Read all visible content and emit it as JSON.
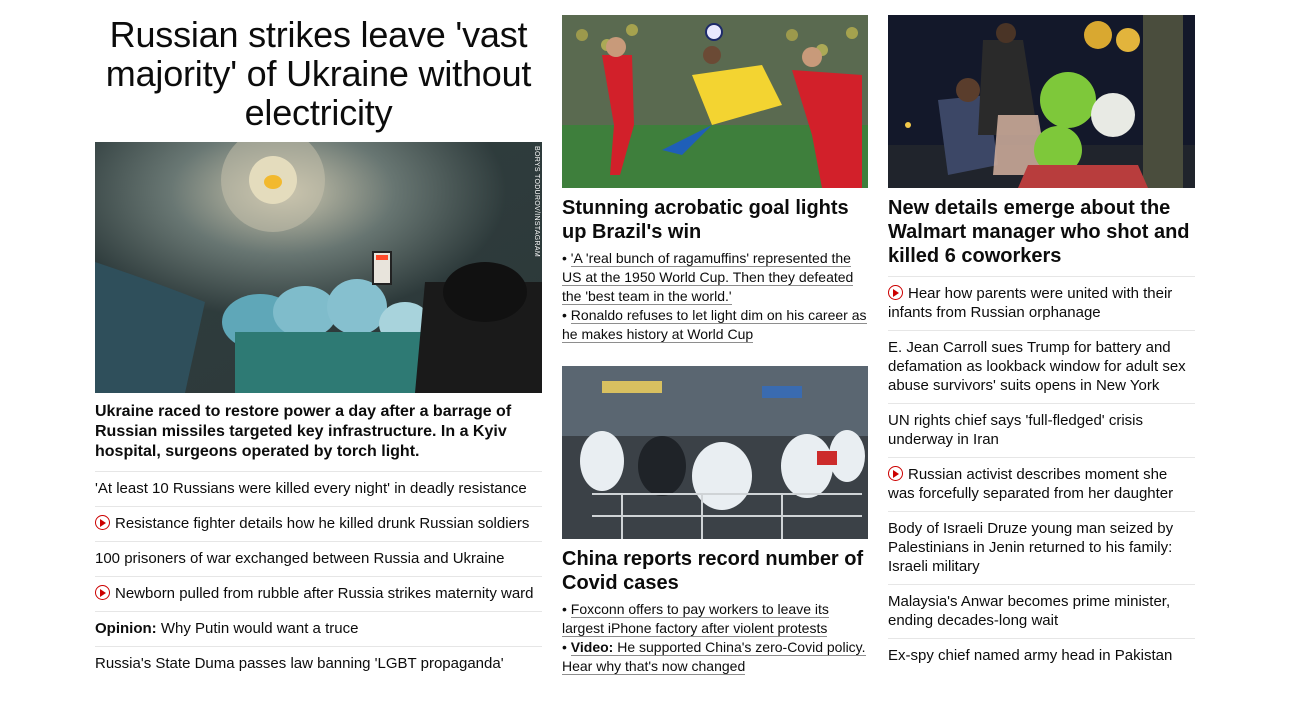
{
  "hero": {
    "title": "Russian strikes leave 'vast majority' of Ukraine without electricity",
    "image_credit": "BORYS TODUROV/INSTAGRAM",
    "dek": "Ukraine raced to restore power a day after a barrage of Russian missiles targeted key infrastructure. In a Kyiv hospital, surgeons operated by torch light.",
    "links": [
      {
        "text": "'At least 10 Russians were killed every night' in deadly resistance",
        "video": false
      },
      {
        "text": "Resistance fighter details how he killed drunk Russian soldiers",
        "video": true
      },
      {
        "text": "100 prisoners of war exchanged between Russia and Ukraine",
        "video": false
      },
      {
        "text": "Newborn pulled from rubble after Russia strikes maternity ward",
        "video": true
      },
      {
        "prefix": "Opinion:",
        "text": " Why Putin would want a truce",
        "video": false
      },
      {
        "text": "Russia's State Duma passes law banning 'LGBT propaganda'",
        "video": false
      }
    ]
  },
  "brazil": {
    "title": "Stunning acrobatic goal lights up Brazil's win",
    "bullets": [
      "'A 'real bunch of ragamuffins' represented the US at the 1950 World Cup. Then they defeated the 'best team in the world.'",
      "Ronaldo refuses to let light dim on his career as he makes history at World Cup"
    ]
  },
  "china": {
    "title": "China reports record number of Covid cases",
    "bullets": [
      {
        "prefix": "",
        "text": "Foxconn offers to pay workers to leave its largest iPhone factory after violent protests"
      },
      {
        "prefix": "Video:",
        "text": " He supported China's zero-Covid policy. Hear why that's now changed"
      }
    ]
  },
  "walmart": {
    "title": "New details emerge about the Walmart manager who shot and killed 6 coworkers",
    "links": [
      {
        "text": "Hear how parents were united with their infants from Russian orphanage",
        "video": true
      },
      {
        "text": "E. Jean Carroll sues Trump for battery and defamation as lookback window for adult sex abuse survivors' suits opens in New York",
        "video": false
      },
      {
        "text": "UN rights chief says 'full-fledged' crisis underway in Iran",
        "video": false
      },
      {
        "text": "Russian activist describes moment she was forcefully separated from her daughter",
        "video": true
      },
      {
        "text": "Body of Israeli Druze young man seized by Palestinians in Jenin returned to his family: Israeli military",
        "video": false
      },
      {
        "text": "Malaysia's Anwar becomes prime minister, ending decades-long wait",
        "video": false
      },
      {
        "text": "Ex-spy chief named army head in Pakistan",
        "video": false
      }
    ]
  },
  "colors": {
    "accent_red": "#cc0000",
    "text": "#0c0c0c",
    "divider": "#e6e6e6"
  }
}
